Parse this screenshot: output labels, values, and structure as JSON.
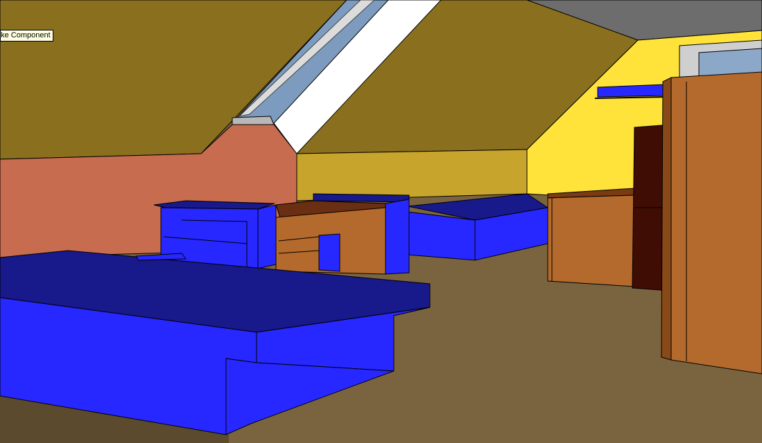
{
  "tooltip": {
    "text": "ake Component"
  },
  "colors": {
    "floor": "#7a6440",
    "ceiling_flat": "#6d6d6d",
    "slope_walls": "#8a701e",
    "wall_left": "#c76c4e",
    "wall_back": "#c7a42b",
    "wall_right": "#ffe23a",
    "furniture_blue_top": "#18198a",
    "furniture_blue": "#2727ff",
    "wood": "#b36a2c",
    "wood_dark": "#3f0d04",
    "rug": "#a4c195",
    "skylight_glass": "#8ca8c8"
  }
}
